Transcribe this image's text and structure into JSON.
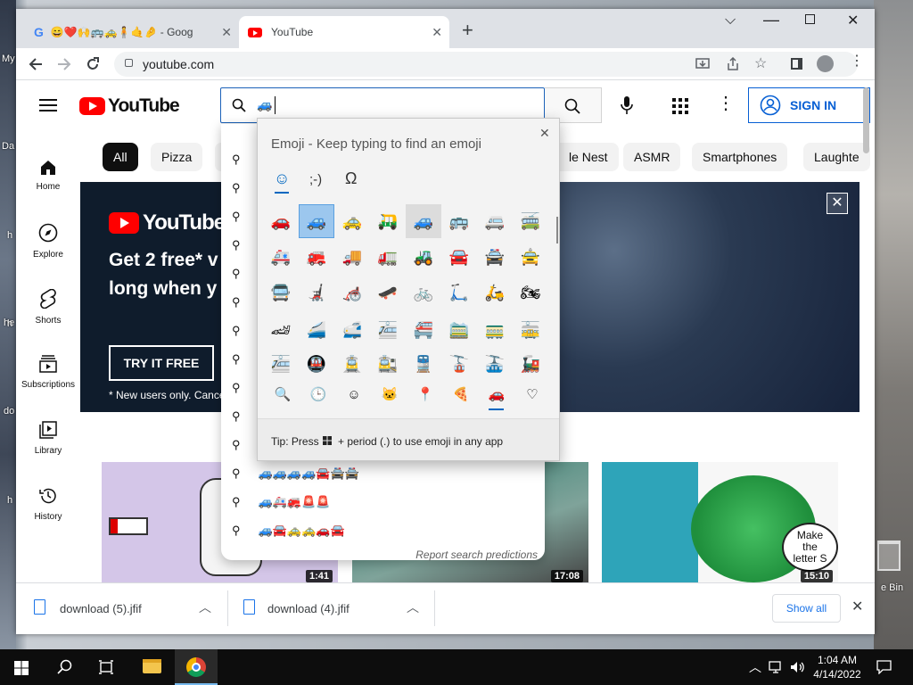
{
  "desktop": {
    "labels": [
      "My",
      "Da",
      "h",
      "he",
      "h",
      "do",
      "h"
    ],
    "recycle_bin_label": "e Bin"
  },
  "browser": {
    "tabs": [
      {
        "title": "😄❤️🙌🚌🚕🧍🤙🤌 - Goog",
        "favicon": "google-favicon"
      },
      {
        "title": "YouTube",
        "favicon": "youtube-favicon"
      }
    ],
    "new_tab_label": "+",
    "url": "youtube.com"
  },
  "youtube": {
    "logo_text": "YouTube",
    "search_value": "🚙",
    "sign_in_label": "SIGN IN",
    "sidebar": [
      {
        "label": "Home",
        "icon": "home-icon"
      },
      {
        "label": "Explore",
        "icon": "compass-icon"
      },
      {
        "label": "Shorts",
        "icon": "shorts-icon"
      },
      {
        "label": "Subscriptions",
        "icon": "subscriptions-icon"
      },
      {
        "label": "Library",
        "icon": "library-icon"
      },
      {
        "label": "History",
        "icon": "history-icon"
      }
    ],
    "chips": [
      "All",
      "Pizza",
      "le Nest",
      "ASMR",
      "Smartphones",
      "Laughte"
    ],
    "banner": {
      "logo": "YouTubeTV",
      "headline_1": "Get 2 free* v",
      "headline_2": "long when y",
      "cta": "TRY IT FREE",
      "footnote": "* New users only. Cance"
    },
    "suggestions": [
      {
        "text": ""
      },
      {
        "text": ""
      },
      {
        "text": ""
      },
      {
        "text": ""
      },
      {
        "text": ""
      },
      {
        "text": ""
      },
      {
        "text": ""
      },
      {
        "text": ""
      },
      {
        "text": ""
      },
      {
        "text": ""
      },
      {
        "text": ""
      },
      {
        "text": "🚙🚙🚙🚙🚘🚔🚔"
      },
      {
        "text": "🚙🚑🚒🚨🚨"
      },
      {
        "text": "🚙🚘🚕🚕🚗🚘"
      }
    ],
    "report_label": "Report search predictions",
    "thumb_badges": [
      "1:41",
      "17:08",
      "15:10"
    ],
    "thumb_text": [
      "Make the",
      "letter S"
    ]
  },
  "emoji_panel": {
    "title": "Emoji - Keep typing to find an emoji",
    "tabs": [
      "☺",
      ";-)",
      "Ω"
    ],
    "grid": [
      [
        "🚗",
        "🚙",
        "🚕",
        "🛺",
        "🚙",
        "🚌",
        "🚐",
        "🚎"
      ],
      [
        "🚑",
        "🚒",
        "🚚",
        "🚛",
        "🚜",
        "🚘",
        "🚔",
        "🚖"
      ],
      [
        "🚍",
        "🦼",
        "🦽",
        "🛹",
        "🚲",
        "🛴",
        "🛵",
        "🏍"
      ],
      [
        "🏎",
        "🚄",
        "🚅",
        "🚈",
        "🚝",
        "🚞",
        "🚃",
        "🚋"
      ],
      [
        "🚈",
        "🚇",
        "🚊",
        "🚉",
        "🚆",
        "🚡",
        "🚠",
        "🚂"
      ]
    ],
    "categories": [
      "🔍",
      "🕒",
      "☺",
      "🐱",
      "📍",
      "🍕",
      "🚗",
      "♡"
    ],
    "tip": "Tip: Press",
    "tip_rest": "+ period (.) to use emoji in any app"
  },
  "downloads": {
    "items": [
      "download (5).jfif",
      "download (4).jfif"
    ],
    "show_all": "Show all"
  },
  "taskbar": {
    "time": "1:04 AM",
    "date": "4/14/2022"
  },
  "colors": {
    "yt_red": "#ff0000",
    "yt_blue": "#065fd4",
    "chrome_tab_bg": "#dee1e6",
    "emoji_accent": "#0067c0"
  }
}
